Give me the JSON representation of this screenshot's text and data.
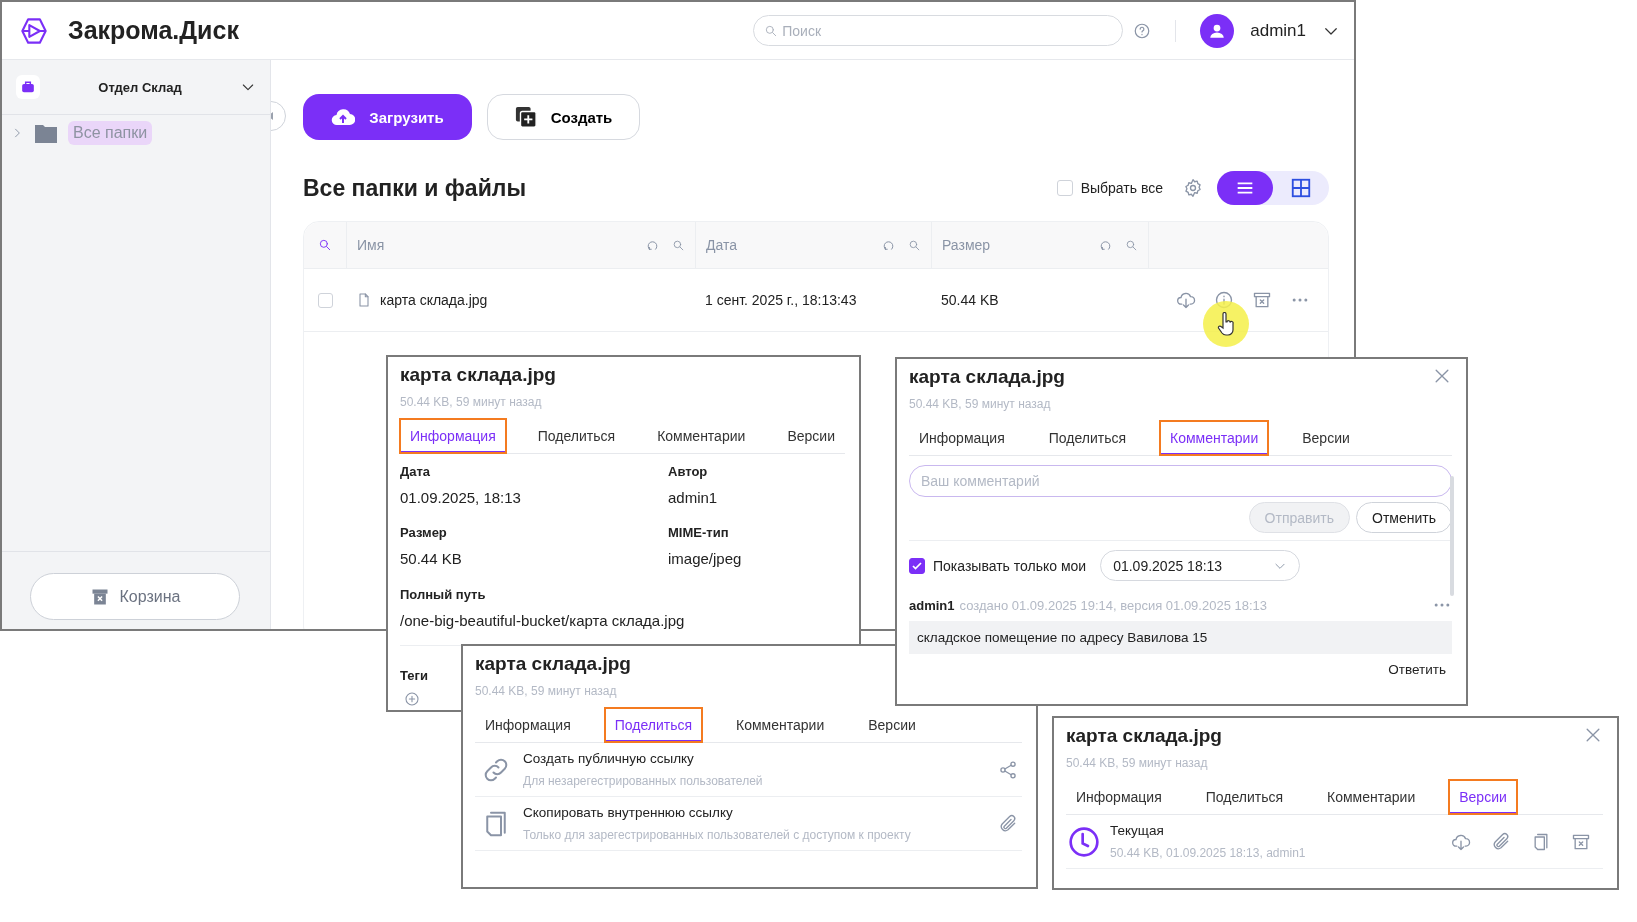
{
  "header": {
    "logo_text": "Закрома.Диск",
    "search": {
      "placeholder": "Поиск"
    },
    "user": {
      "name": "admin1"
    }
  },
  "sidebar": {
    "workspace": "Отдел Склад",
    "tree": [
      {
        "label": "Все папки",
        "selected": true,
        "expanded": false
      }
    ],
    "trash_button": "Корзина"
  },
  "toolbar": {
    "upload_button": "Загрузить",
    "create_button": "Создать"
  },
  "files": {
    "title": "Все папки и файлы",
    "select_all": {
      "label": "Выбрать все",
      "checked": false
    },
    "view_modes": [
      {
        "kind": "list",
        "selected": true
      },
      {
        "kind": "grid",
        "selected": false
      }
    ],
    "table": {
      "columns": [
        {
          "label": "Имя"
        },
        {
          "label": "Дата"
        },
        {
          "label": "Размер"
        }
      ],
      "rows": [
        {
          "checked": false,
          "name": "карта склада.jpg",
          "date": "1 сент. 2025 г., 18:13:43",
          "size": "50.44 KB"
        }
      ]
    }
  },
  "panels": [
    {
      "kind": "info",
      "title": "карта склада.jpg",
      "subtitle": "50.44 KB, 59 минут назад",
      "closable": false,
      "tabs": [
        {
          "label": "Информация",
          "selected": true
        },
        {
          "label": "Поделиться",
          "selected": false
        },
        {
          "label": "Комментарии",
          "selected": false
        },
        {
          "label": "Версии",
          "selected": false
        }
      ],
      "fields": [
        {
          "label": "Дата",
          "value": "01.09.2025, 18:13"
        },
        {
          "label": "Автор",
          "value": "admin1"
        },
        {
          "label": "Размер",
          "value": "50.44 KB"
        },
        {
          "label": "MIME-тип",
          "value": "image/jpeg"
        }
      ],
      "path": {
        "label": "Полный путь",
        "value": "/one-big-beautiful-bucket/карта склада.jpg"
      },
      "tags_label": "Теги"
    },
    {
      "kind": "share",
      "title": "карта склада.jpg",
      "subtitle": "50.44 KB, 59 минут назад",
      "closable": false,
      "tabs": [
        {
          "label": "Информация",
          "selected": false
        },
        {
          "label": "Поделиться",
          "selected": true
        },
        {
          "label": "Комментарии",
          "selected": false
        },
        {
          "label": "Версии",
          "selected": false
        }
      ],
      "options": [
        {
          "kind": "public",
          "title": "Создать публичную ссылку",
          "subtitle": "Для незарегестрированных пользователей"
        },
        {
          "kind": "internal",
          "title": "Скопировать внутреннюю ссылку",
          "subtitle": "Только для зарегестрированных пользователей с доступом к проекту"
        }
      ]
    },
    {
      "kind": "comments",
      "title": "карта склада.jpg",
      "subtitle": "50.44 KB, 59 минут назад",
      "closable": true,
      "tabs": [
        {
          "label": "Информация",
          "selected": false
        },
        {
          "label": "Поделиться",
          "selected": false
        },
        {
          "label": "Комментарии",
          "selected": true
        },
        {
          "label": "Версии",
          "selected": false
        }
      ],
      "comment_field": {
        "placeholder": "Ваш комментарий"
      },
      "send_button": {
        "label": "Отправить",
        "disabled": true
      },
      "cancel_button": "Отменить",
      "only_mine": {
        "label": "Показывать только мои",
        "checked": true
      },
      "version_select": "01.09.2025 18:13",
      "comments": [
        {
          "author": "admin1",
          "meta": "создано 01.09.2025 19:14, версия 01.09.2025 18:13",
          "text": "складское помещение по адресу Вавилова 15",
          "reply": "Ответить"
        }
      ]
    },
    {
      "kind": "versions",
      "title": "карта склада.jpg",
      "subtitle": "50.44 KB, 59 минут назад",
      "closable": true,
      "tabs": [
        {
          "label": "Информация",
          "selected": false
        },
        {
          "label": "Поделиться",
          "selected": false
        },
        {
          "label": "Комментарии",
          "selected": false
        },
        {
          "label": "Версии",
          "selected": true
        }
      ],
      "versions": [
        {
          "title": "Текущая",
          "meta": "50.44 KB, 01.09.2025 18:13, admin1"
        }
      ]
    }
  ]
}
